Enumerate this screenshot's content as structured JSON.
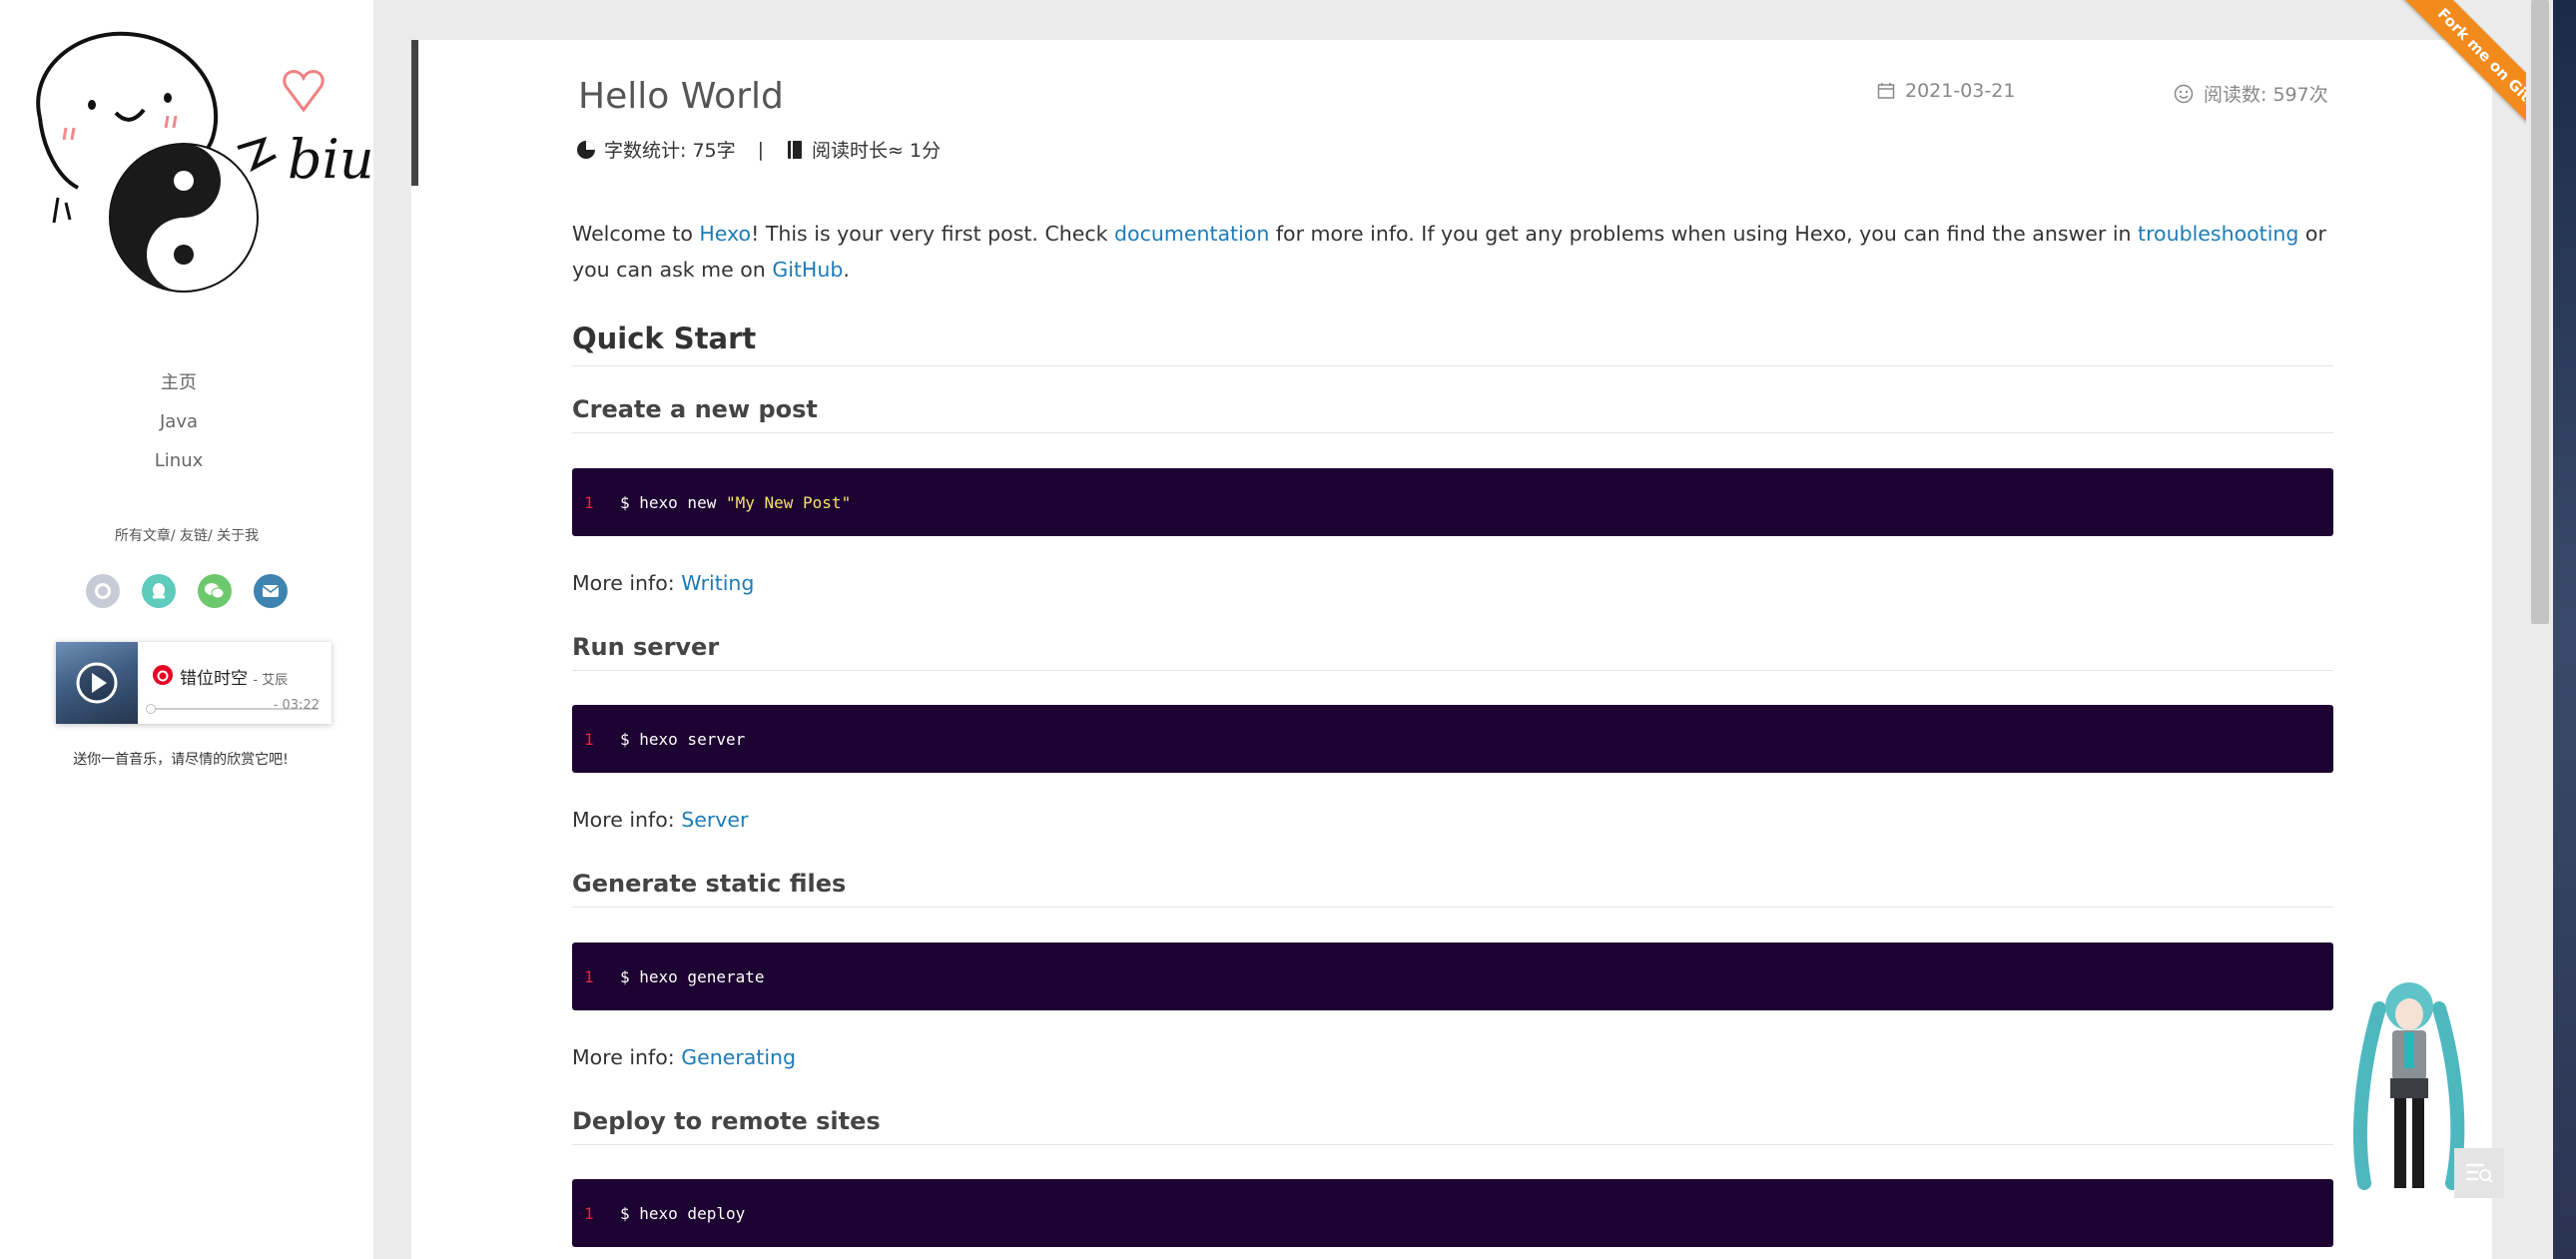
{
  "sidebar": {
    "avatar_text": "biu",
    "nav": [
      "主页",
      "Java",
      "Linux"
    ],
    "subnav": [
      "所有文章",
      "友链",
      "关于我"
    ],
    "socials": [
      "github-icon",
      "qq-icon",
      "wechat-icon",
      "mail-icon"
    ],
    "player": {
      "song": "错位时空",
      "artist": "- 艾辰",
      "time": "- 03:22"
    },
    "music_tip": "送你一首音乐，请尽情的欣赏它吧!"
  },
  "post": {
    "title": "Hello World",
    "word_count": "字数统计: 75字",
    "read_time": "阅读时长≈ 1分",
    "date": "2021-03-21",
    "reads": "阅读数: 597次",
    "intro": {
      "p1": "Welcome to ",
      "hexo": "Hexo",
      "p2": "! This is your very first post. Check ",
      "documentation": "documentation",
      "p3": " for more info. If you get any problems when using Hexo, you can find the answer in ",
      "troubleshooting": "troubleshooting",
      "p4": " or you can ask me on ",
      "github": "GitHub",
      "p5": "."
    },
    "quick_start": "Quick Start",
    "sections": [
      {
        "heading": "Create a new post",
        "cmd": "$ hexo new ",
        "cmd_str": "\"My New Post\"",
        "more": "More info: ",
        "link": "Writing"
      },
      {
        "heading": "Run server",
        "cmd": "$ hexo server",
        "more": "More info: ",
        "link": "Server"
      },
      {
        "heading": "Generate static files",
        "cmd": "$ hexo generate",
        "more": "More info: ",
        "link": "Generating"
      },
      {
        "heading": "Deploy to remote sites",
        "cmd": "$ hexo deploy"
      }
    ],
    "line_number": "1"
  },
  "ribbon": "Fork me on GitHub",
  "colors": {
    "link": "#1e7bb7",
    "code_bg": "#1d0331",
    "ribbon": "#f28b1c"
  }
}
